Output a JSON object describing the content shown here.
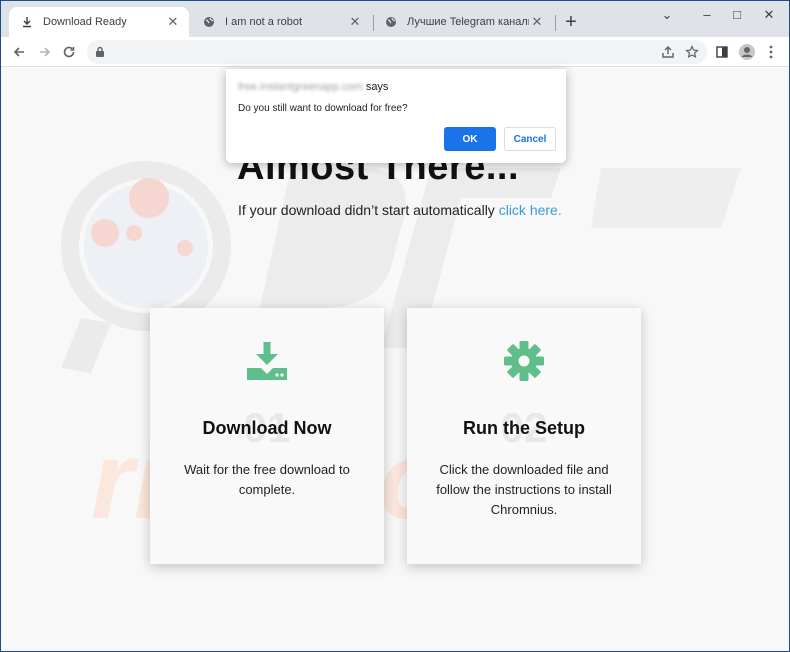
{
  "browser": {
    "tabs": [
      {
        "label": "Download Ready",
        "icon": "download-icon",
        "active": true
      },
      {
        "label": "I am not a robot",
        "icon": "globe-icon",
        "active": false
      },
      {
        "label": "Лучшие Telegram каналы | TOP",
        "icon": "globe-icon",
        "active": false
      }
    ],
    "new_tab": "+",
    "window_controls": {
      "minimize": "–",
      "maximize": "□",
      "close": "✕"
    }
  },
  "dialog": {
    "origin": "free.instantgreenapp.com",
    "says": "says",
    "message": "Do you still want to download for free?",
    "ok_label": "OK",
    "cancel_label": "Cancel"
  },
  "page": {
    "heading": "Almost There...",
    "subtitle": "If your download didn’t start automatically",
    "link_text": "click here.",
    "cards": [
      {
        "number": "01",
        "title": "Download Now",
        "description": "Wait for the free download to complete.",
        "icon": "download-tray-icon"
      },
      {
        "number": "02",
        "title": "Run the Setup",
        "description": "Click the downloaded file and follow the instructions to install Chromnius.",
        "icon": "gear-icon"
      }
    ]
  },
  "colors": {
    "accent": "#1a73e8",
    "icon_green": "#5fbf8a",
    "link": "#3b9bd9"
  }
}
